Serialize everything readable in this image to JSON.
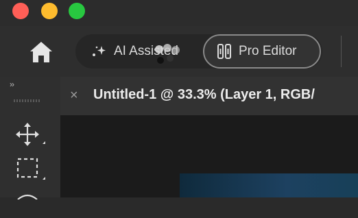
{
  "window": {
    "controls": [
      "close",
      "minimize",
      "maximize"
    ],
    "colors": {
      "close": "#ff5f57",
      "minimize": "#febc2e",
      "maximize": "#28c840"
    }
  },
  "toolbar": {
    "home_icon": "home-icon",
    "mode_ai_label": "AI Assisted",
    "mode_ai_icon": "sparkle-icon",
    "mode_pro_label": "Pro Editor",
    "mode_pro_icon": "tools-icon",
    "active_mode": "Pro Editor"
  },
  "panel": {
    "collapse_label": "››",
    "tools": [
      "move-tool-icon",
      "rectangular-marquee-icon",
      "lasso-icon"
    ]
  },
  "document_tab": {
    "close_label": "×",
    "title": "Untitled-1 @ 33.3% (Layer 1, RGB/"
  },
  "colors": {
    "app_bg": "#2a2a2a",
    "accent_border": "#8a8a8a",
    "canvas_blue": "#1d4160"
  }
}
